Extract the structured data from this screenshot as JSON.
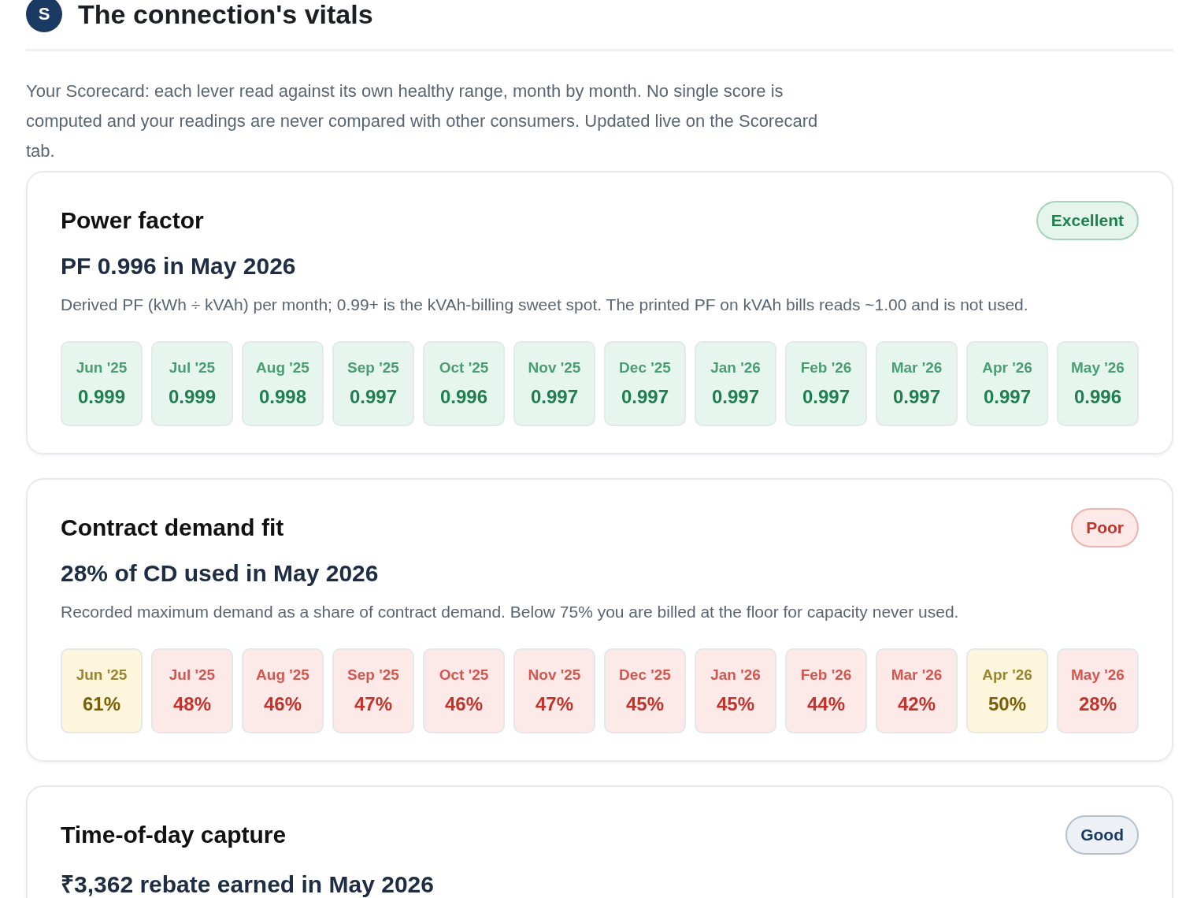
{
  "header": {
    "avatar": "S",
    "title": "The connection's vitals"
  },
  "intro": "Your Scorecard: each lever read against its own healthy range, month by month. No single score is computed and your readings are never compared with other consumers. Updated live on the Scorecard tab.",
  "cards": [
    {
      "title": "Power factor",
      "rating": {
        "label": "Excellent",
        "kind": "good"
      },
      "headline": "PF 0.996 in May 2026",
      "description": "Derived PF (kWh ÷ kVAh) per month; 0.99+ is the kVAh-billing sweet spot. The printed PF on kVAh bills reads ~1.00 and is not used.",
      "months": [
        {
          "month": "Jun '25",
          "value": "0.999",
          "kind": "good"
        },
        {
          "month": "Jul '25",
          "value": "0.999",
          "kind": "good"
        },
        {
          "month": "Aug '25",
          "value": "0.998",
          "kind": "good"
        },
        {
          "month": "Sep '25",
          "value": "0.997",
          "kind": "good"
        },
        {
          "month": "Oct '25",
          "value": "0.996",
          "kind": "good"
        },
        {
          "month": "Nov '25",
          "value": "0.997",
          "kind": "good"
        },
        {
          "month": "Dec '25",
          "value": "0.997",
          "kind": "good"
        },
        {
          "month": "Jan '26",
          "value": "0.997",
          "kind": "good"
        },
        {
          "month": "Feb '26",
          "value": "0.997",
          "kind": "good"
        },
        {
          "month": "Mar '26",
          "value": "0.997",
          "kind": "good"
        },
        {
          "month": "Apr '26",
          "value": "0.997",
          "kind": "good"
        },
        {
          "month": "May '26",
          "value": "0.996",
          "kind": "good"
        }
      ]
    },
    {
      "title": "Contract demand fit",
      "rating": {
        "label": "Poor",
        "kind": "poor"
      },
      "headline": "28% of CD used in May 2026",
      "description": "Recorded maximum demand as a share of contract demand. Below 75% you are billed at the floor for capacity never used.",
      "months": [
        {
          "month": "Jun '25",
          "value": "61%",
          "kind": "warn"
        },
        {
          "month": "Jul '25",
          "value": "48%",
          "kind": "poor"
        },
        {
          "month": "Aug '25",
          "value": "46%",
          "kind": "poor"
        },
        {
          "month": "Sep '25",
          "value": "47%",
          "kind": "poor"
        },
        {
          "month": "Oct '25",
          "value": "46%",
          "kind": "poor"
        },
        {
          "month": "Nov '25",
          "value": "47%",
          "kind": "poor"
        },
        {
          "month": "Dec '25",
          "value": "45%",
          "kind": "poor"
        },
        {
          "month": "Jan '26",
          "value": "45%",
          "kind": "poor"
        },
        {
          "month": "Feb '26",
          "value": "44%",
          "kind": "poor"
        },
        {
          "month": "Mar '26",
          "value": "42%",
          "kind": "poor"
        },
        {
          "month": "Apr '26",
          "value": "50%",
          "kind": "warn"
        },
        {
          "month": "May '26",
          "value": "28%",
          "kind": "poor"
        }
      ]
    },
    {
      "title": "Time-of-day capture",
      "rating": {
        "label": "Good",
        "kind": "neutral"
      },
      "headline": "₹3,362 rebate earned in May 2026"
    }
  ]
}
